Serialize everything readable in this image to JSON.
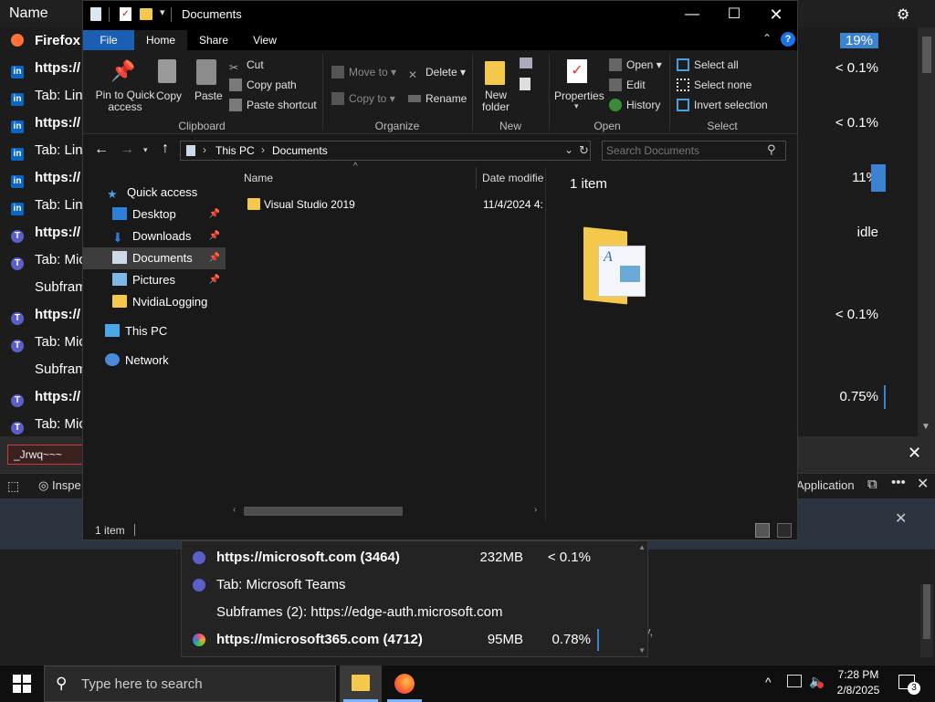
{
  "background": {
    "header_name": "Name",
    "rows": [
      {
        "text": "Firefox",
        "bold": true,
        "icon": "firefox-icon"
      },
      {
        "text": "https://",
        "bold": true,
        "icon": "linkedin-icon"
      },
      {
        "text": "Tab: Link",
        "bold": false,
        "icon": "linkedin-icon"
      },
      {
        "text": "https://",
        "bold": true,
        "icon": "linkedin-icon"
      },
      {
        "text": "Tab: Link",
        "bold": false,
        "icon": "linkedin-icon"
      },
      {
        "text": "https://",
        "bold": true,
        "icon": "linkedin-icon"
      },
      {
        "text": "Tab: Link",
        "bold": false,
        "icon": "linkedin-icon"
      },
      {
        "text": "https://",
        "bold": true,
        "icon": "teams-icon"
      },
      {
        "text": "Tab: Mic",
        "bold": false,
        "icon": "teams-icon"
      },
      {
        "text": "Subfram",
        "bold": false,
        "icon": ""
      },
      {
        "text": "https://",
        "bold": true,
        "icon": "teams-icon"
      },
      {
        "text": "Tab: Mic",
        "bold": false,
        "icon": "teams-icon"
      },
      {
        "text": "Subfram",
        "bold": false,
        "icon": ""
      },
      {
        "text": "https://",
        "bold": true,
        "icon": "teams-icon"
      },
      {
        "text": "Tab: Mic",
        "bold": false,
        "icon": "teams-icon"
      }
    ],
    "cpu_values": [
      "19%",
      "< 0.1%",
      "< 0.1%",
      "11%",
      "idle",
      "< 0.1%",
      "0.75%"
    ],
    "search_value": "_Jrwq~~~",
    "devtools_insp": "Inspe",
    "devtools_application": "Application",
    "partial_text": "y,",
    "popup_rows": [
      {
        "name": "https://microsoft.com (3464)",
        "mem": "232MB",
        "cpu": "< 0.1%",
        "bold": true
      },
      {
        "name": "Tab: Microsoft Teams",
        "mem": "",
        "cpu": "",
        "bold": false
      },
      {
        "name": "Subframes (2): https://edge-auth.microsoft.com",
        "mem": "",
        "cpu": "",
        "bold": false
      },
      {
        "name": "https://microsoft365.com (4712)",
        "mem": "95MB",
        "cpu": "0.78%",
        "bold": true
      }
    ]
  },
  "explorer": {
    "title": "Documents",
    "tabs": {
      "file": "File",
      "home": "Home",
      "share": "Share",
      "view": "View"
    },
    "clipboard": {
      "pin": "Pin to Quick access",
      "copy": "Copy",
      "paste": "Paste",
      "cut": "Cut",
      "copy_path": "Copy path",
      "paste_shortcut": "Paste shortcut",
      "label": "Clipboard"
    },
    "organize": {
      "move_to": "Move to",
      "copy_to": "Copy to",
      "delete": "Delete",
      "rename": "Rename",
      "label": "Organize"
    },
    "new": {
      "new_folder": "New folder",
      "label": "New"
    },
    "open": {
      "properties": "Properties",
      "open": "Open",
      "edit": "Edit",
      "history": "History",
      "label": "Open"
    },
    "select": {
      "select_all": "Select all",
      "select_none": "Select none",
      "invert": "Invert selection",
      "label": "Select"
    },
    "address": {
      "this_pc": "This PC",
      "documents": "Documents",
      "search_placeholder": "Search Documents"
    },
    "nav": {
      "quick_access": "Quick access",
      "desktop": "Desktop",
      "downloads": "Downloads",
      "documents": "Documents",
      "pictures": "Pictures",
      "nvidia": "NvidiaLogging",
      "this_pc": "This PC",
      "network": "Network"
    },
    "columns": {
      "name": "Name",
      "date": "Date modifie"
    },
    "files": [
      {
        "name": "Visual Studio 2019",
        "date": "11/4/2024 4:1"
      }
    ],
    "preview_count": "1 item",
    "status": "1 item"
  },
  "taskbar": {
    "search_placeholder": "Type here to search",
    "time": "7:28 PM",
    "date": "2/8/2025",
    "notifications": "3"
  }
}
